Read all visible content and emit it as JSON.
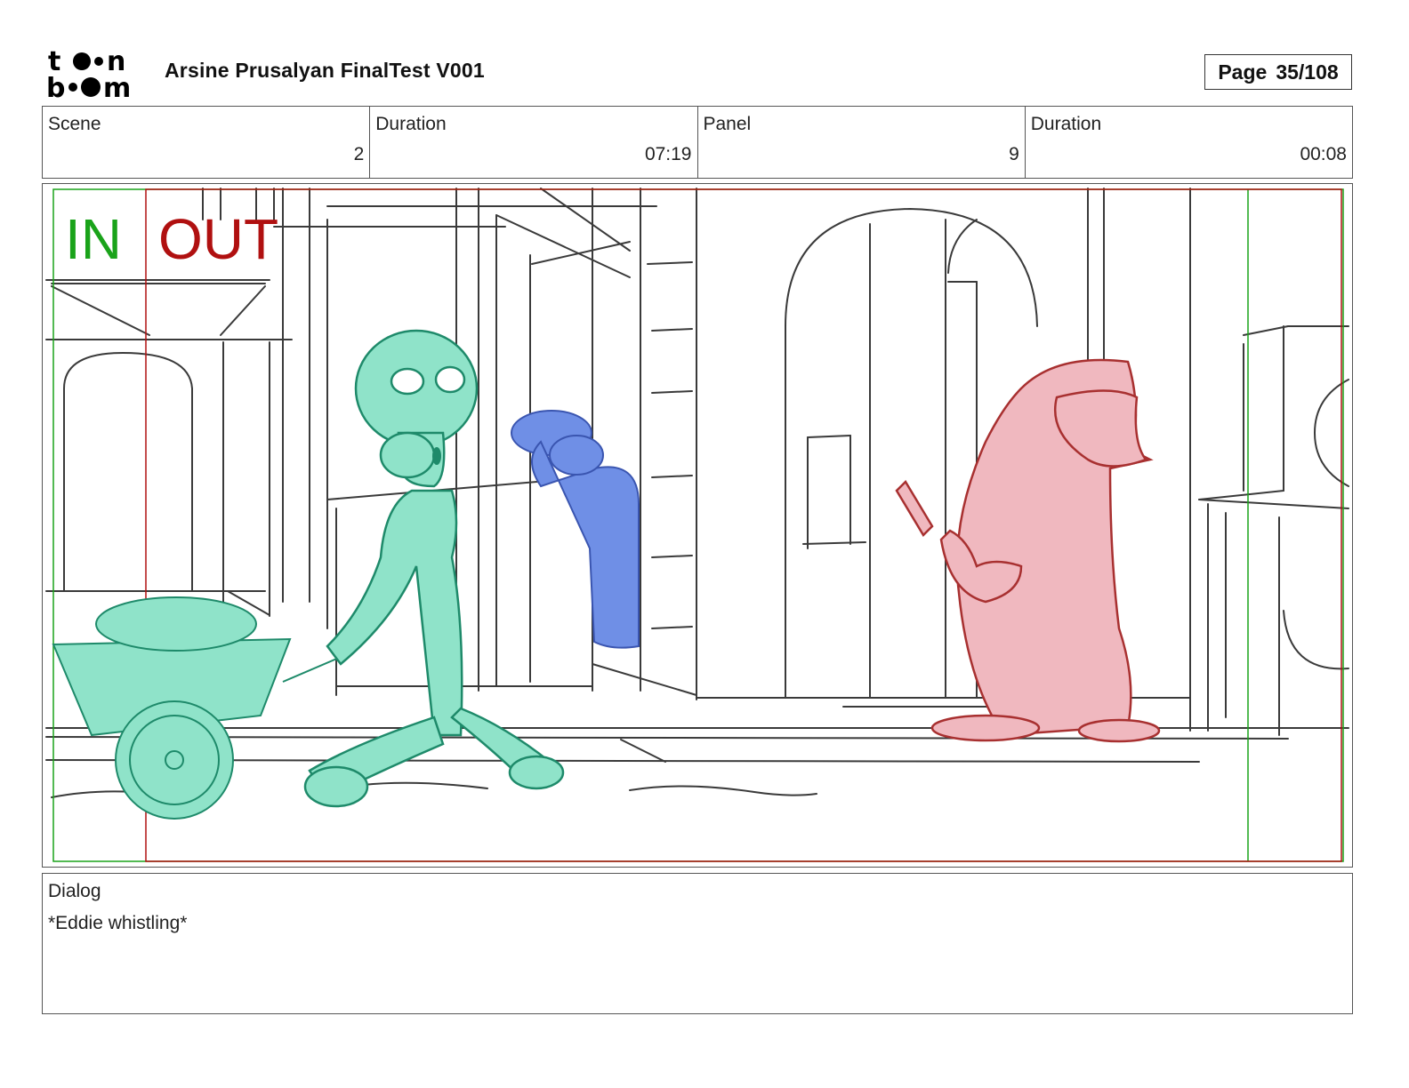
{
  "header": {
    "logo_text_top": "toon",
    "logo_text_bottom": "boom",
    "title": "Arsine Prusalyan FinalTest V001",
    "page_label": "Page",
    "page_value": "35/108"
  },
  "info": {
    "scene_label": "Scene",
    "scene_value": "2",
    "scene_duration_label": "Duration",
    "scene_duration_value": "07:19",
    "panel_label": "Panel",
    "panel_value": "9",
    "panel_duration_label": "Duration",
    "panel_duration_value": "00:08"
  },
  "panel": {
    "in_label": "IN",
    "out_label": "OUT",
    "colors": {
      "in_frame": "#1aa31a",
      "out_frame": "#b01010",
      "squidward": "#8fe3c9",
      "squidward_line": "#1e8a6a",
      "fisherman": "#6f8fe6",
      "fisherman_line": "#3a55b0",
      "pink_character": "#f0b8bf",
      "pink_line": "#a83030",
      "sketch_line": "#3a3a3a"
    }
  },
  "dialog": {
    "label": "Dialog",
    "text": "*Eddie whistling*"
  }
}
